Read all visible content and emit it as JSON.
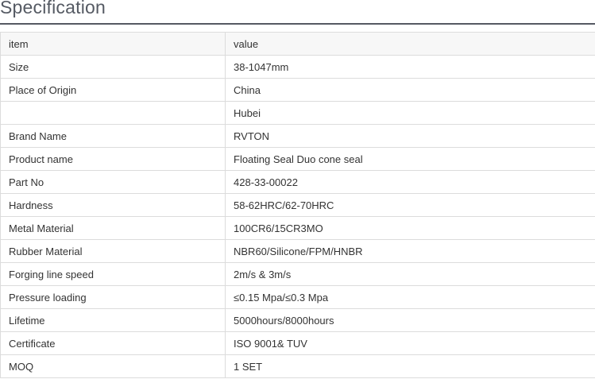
{
  "heading": "Specification",
  "table": {
    "header": {
      "item": "item",
      "value": "value"
    },
    "rows": [
      {
        "item": "Size",
        "value": "38-1047mm"
      },
      {
        "item": "Place of Origin",
        "value": "China"
      },
      {
        "item": "",
        "value": "Hubei"
      },
      {
        "item": "Brand Name",
        "value": "RVTON"
      },
      {
        "item": "Product name",
        "value": "Floating Seal Duo cone seal"
      },
      {
        "item": "Part No",
        "value": "428-33-00022"
      },
      {
        "item": "Hardness",
        "value": "58-62HRC/62-70HRC"
      },
      {
        "item": "Metal Material",
        "value": "100CR6/15CR3MO"
      },
      {
        "item": "Rubber Material",
        "value": "NBR60/Silicone/FPM/HNBR"
      },
      {
        "item": "Forging line speed",
        "value": "2m/s & 3m/s"
      },
      {
        "item": "Pressure loading",
        "value": "≤0.15 Mpa/≤0.3 Mpa"
      },
      {
        "item": "Lifetime",
        "value": "5000hours/8000hours"
      },
      {
        "item": "Certificate",
        "value": "ISO 9001& TUV"
      },
      {
        "item": "MOQ",
        "value": "1 SET"
      }
    ]
  }
}
